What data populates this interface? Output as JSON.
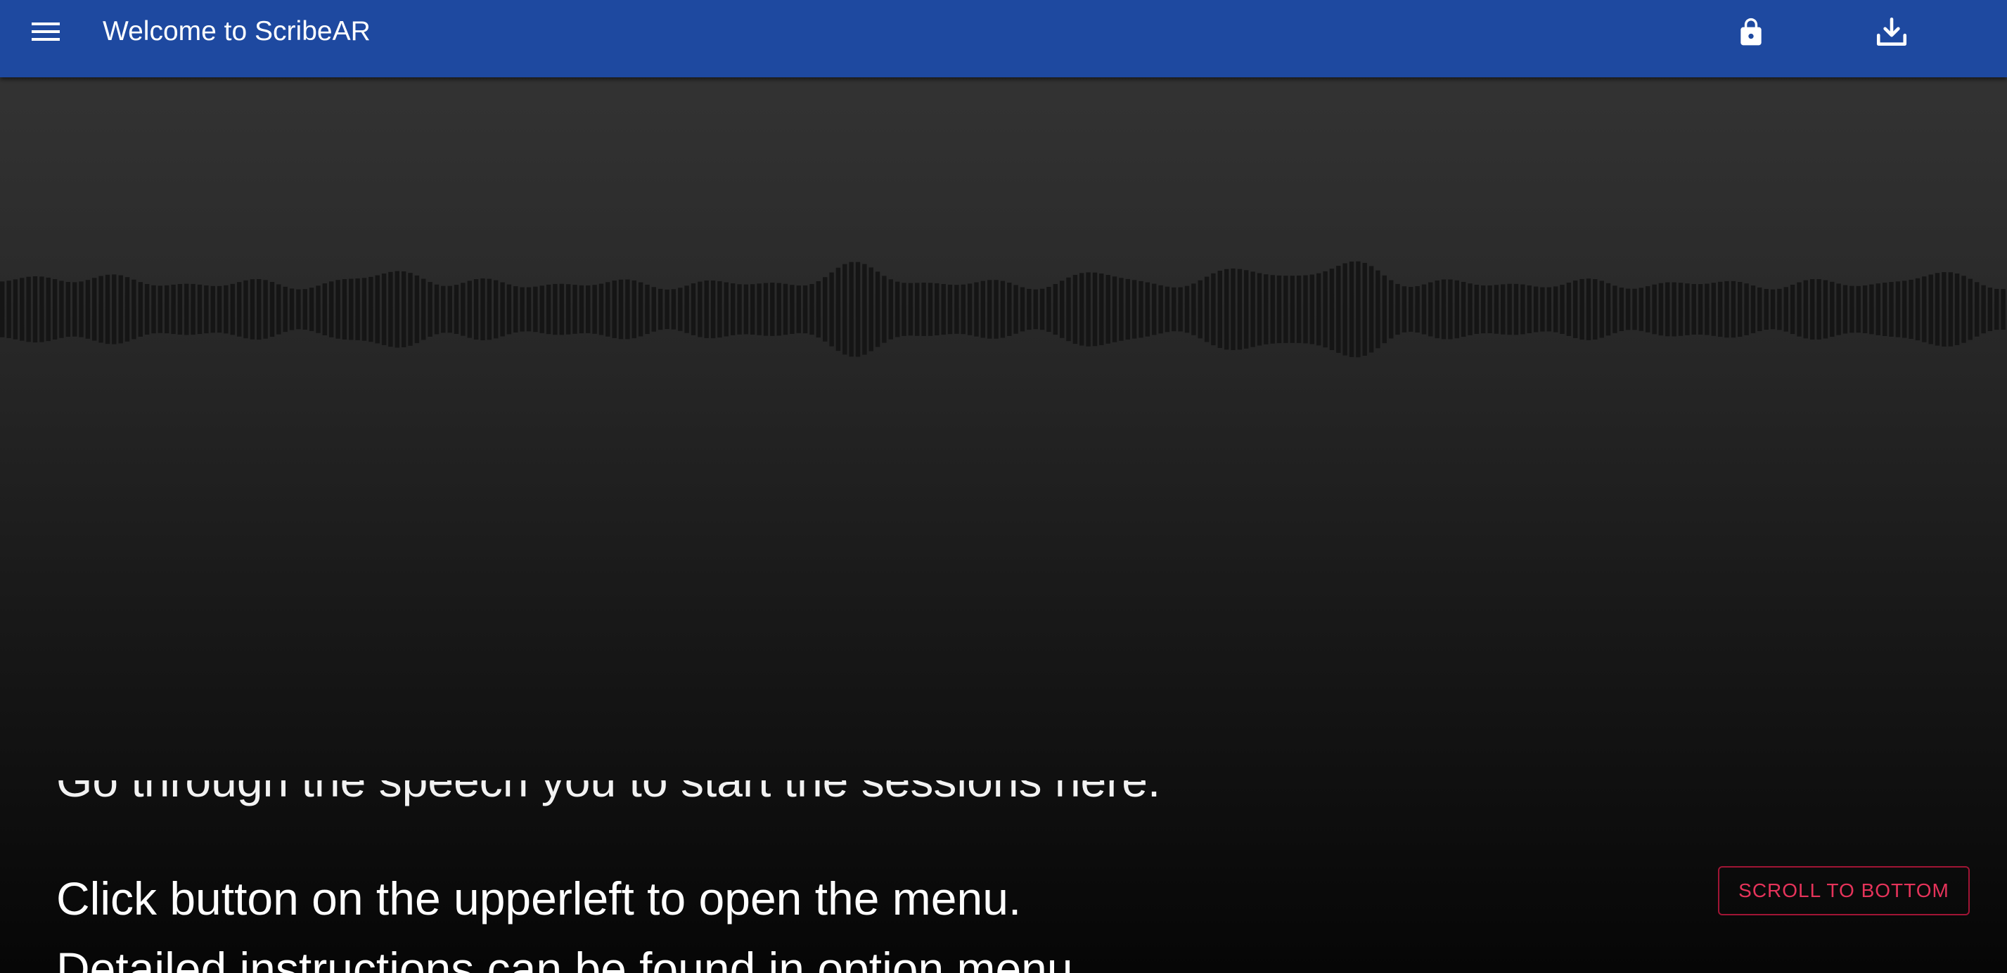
{
  "appbar": {
    "title": "Welcome to ScribeAR",
    "color": "#1e49a0",
    "icons": {
      "menu": "menu-icon",
      "lock": "lock-icon",
      "download": "download-icon"
    }
  },
  "captions": {
    "lines": [
      "Click button on the upperleft to open the menu.",
      "Detailed instructions can be found in option menu."
    ]
  },
  "scroll_button": {
    "label": "SCROLL TO BOTTOM",
    "color": "#e5335a"
  }
}
